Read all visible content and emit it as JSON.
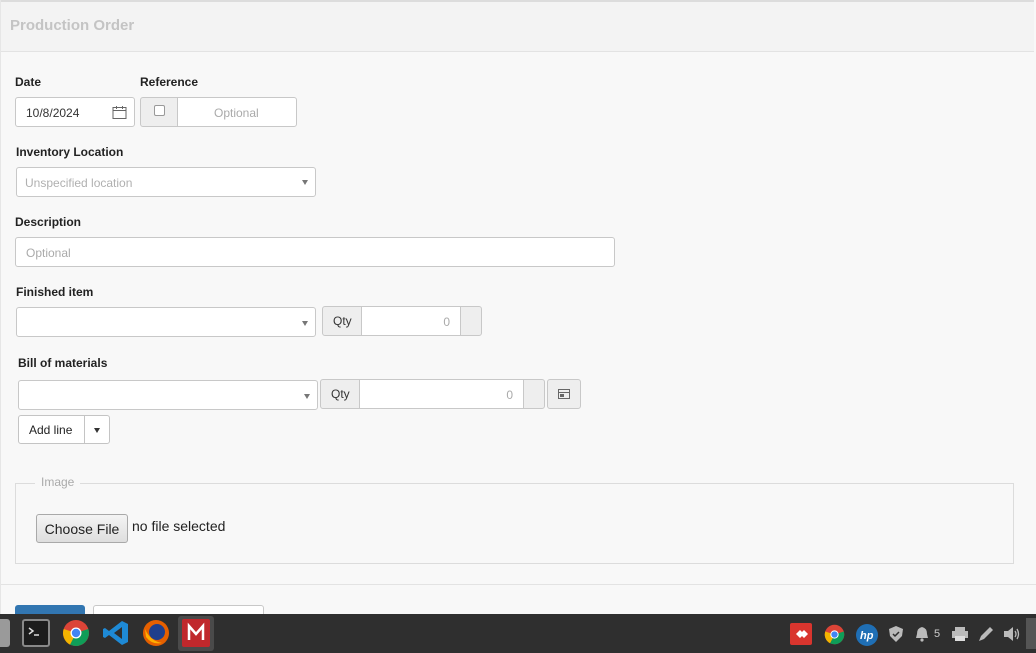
{
  "header": {
    "title": "Production Order"
  },
  "form": {
    "date": {
      "label": "Date",
      "value": "10/8/2024"
    },
    "reference": {
      "label": "Reference",
      "placeholder": "Optional"
    },
    "inventory_location": {
      "label": "Inventory Location",
      "placeholder": "Unspecified location"
    },
    "description": {
      "label": "Description",
      "placeholder": "Optional"
    },
    "finished_item": {
      "label": "Finished item",
      "qty_label": "Qty",
      "qty_value": "0"
    },
    "bill_of_materials": {
      "label": "Bill of materials",
      "qty_label": "Qty",
      "qty_value": "0",
      "add_line_label": "Add line"
    },
    "image": {
      "legend": "Image",
      "choose_file_label": "Choose File",
      "file_status": "no file selected"
    }
  },
  "taskbar": {
    "apps": [
      "files-icon",
      "terminal-icon",
      "chrome-icon",
      "vscode-icon",
      "firefox-icon",
      "mail-icon"
    ],
    "tray": {
      "notification_count": "5"
    }
  }
}
